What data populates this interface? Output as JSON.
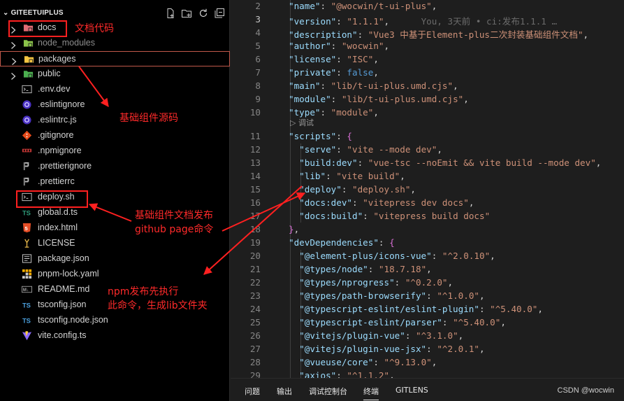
{
  "explorer": {
    "title": "GITEETUIPLUS",
    "actions": [
      "new-file-icon",
      "new-folder-icon",
      "refresh-icon",
      "collapse-all-icon"
    ],
    "items": [
      {
        "name": "docs",
        "kind": "folder",
        "icon": "docs-folder-icon",
        "icon_color": "#e06c75"
      },
      {
        "name": "node_modules",
        "kind": "folder",
        "icon": "node-folder-icon",
        "icon_color": "#8bc34a",
        "dimmed": true
      },
      {
        "name": "packages",
        "kind": "folder",
        "icon": "package-folder-icon",
        "icon_color": "#f4c542"
      },
      {
        "name": "public",
        "kind": "folder",
        "icon": "public-folder-icon",
        "icon_color": "#4caf50"
      },
      {
        "name": ".env.dev",
        "kind": "file",
        "icon": "env-file-icon"
      },
      {
        "name": ".eslintignore",
        "kind": "file",
        "icon": "eslint-icon"
      },
      {
        "name": ".eslintrc.js",
        "kind": "file",
        "icon": "eslint-icon"
      },
      {
        "name": ".gitignore",
        "kind": "file",
        "icon": "git-icon"
      },
      {
        "name": ".npmignore",
        "kind": "file",
        "icon": "npm-icon"
      },
      {
        "name": ".prettierignore",
        "kind": "file",
        "icon": "prettier-icon"
      },
      {
        "name": ".prettierrc",
        "kind": "file",
        "icon": "prettier-icon"
      },
      {
        "name": "deploy.sh",
        "kind": "file",
        "icon": "terminal-file-icon"
      },
      {
        "name": "global.d.ts",
        "kind": "file",
        "icon": "typescript-icon",
        "icon_text": "TS"
      },
      {
        "name": "index.html",
        "kind": "file",
        "icon": "html5-icon",
        "icon_text": "5"
      },
      {
        "name": "LICENSE",
        "kind": "file",
        "icon": "license-icon"
      },
      {
        "name": "package.json",
        "kind": "file",
        "icon": "npm-package-icon"
      },
      {
        "name": "pnpm-lock.yaml",
        "kind": "file",
        "icon": "pnpm-icon"
      },
      {
        "name": "README.md",
        "kind": "file",
        "icon": "markdown-icon",
        "icon_text": "M↓"
      },
      {
        "name": "tsconfig.json",
        "kind": "file",
        "icon": "tsconfig-icon",
        "icon_text": "TS"
      },
      {
        "name": "tsconfig.node.json",
        "kind": "file",
        "icon": "tsconfig-icon",
        "icon_text": "TS"
      },
      {
        "name": "vite.config.ts",
        "kind": "file",
        "icon": "vite-icon"
      }
    ]
  },
  "annotations": {
    "docs": "文档代码",
    "packages": "基础组件源码",
    "deploy_line1": "基础组件文档发布",
    "deploy_line2": "github page命令",
    "lib_line1": "npm发布先执行",
    "lib_line2": "此命令，生成lib文件夹",
    "color": "#ff2a2a"
  },
  "editor": {
    "blame": "You, 3天前 • ci:发布1.1.1 …",
    "codelens": "▷ 调试",
    "active_line": "3",
    "lines": [
      {
        "n": "2",
        "indent": 1,
        "parts": [
          [
            "k",
            "\"name\""
          ],
          [
            "p",
            ": "
          ],
          [
            "s",
            "\"@wocwin/t-ui-plus\""
          ],
          [
            "p",
            ","
          ]
        ]
      },
      {
        "n": "3",
        "indent": 1,
        "parts": [
          [
            "k",
            "\"version\""
          ],
          [
            "p",
            ": "
          ],
          [
            "s",
            "\"1.1.1\""
          ],
          [
            "p",
            ","
          ]
        ]
      },
      {
        "n": "4",
        "indent": 1,
        "parts": [
          [
            "k",
            "\"description\""
          ],
          [
            "p",
            ": "
          ],
          [
            "s",
            "\"Vue3 中基于Element-plus二次封装基础组件文档\""
          ],
          [
            "p",
            ","
          ]
        ]
      },
      {
        "n": "5",
        "indent": 1,
        "parts": [
          [
            "k",
            "\"author\""
          ],
          [
            "p",
            ": "
          ],
          [
            "s",
            "\"wocwin\""
          ],
          [
            "p",
            ","
          ]
        ]
      },
      {
        "n": "6",
        "indent": 1,
        "parts": [
          [
            "k",
            "\"license\""
          ],
          [
            "p",
            ": "
          ],
          [
            "s",
            "\"ISC\""
          ],
          [
            "p",
            ","
          ]
        ]
      },
      {
        "n": "7",
        "indent": 1,
        "parts": [
          [
            "k",
            "\"private\""
          ],
          [
            "p",
            ": "
          ],
          [
            "b",
            "false"
          ],
          [
            "p",
            ","
          ]
        ]
      },
      {
        "n": "8",
        "indent": 1,
        "parts": [
          [
            "k",
            "\"main\""
          ],
          [
            "p",
            ": "
          ],
          [
            "s",
            "\"lib/t-ui-plus.umd.cjs\""
          ],
          [
            "p",
            ","
          ]
        ]
      },
      {
        "n": "9",
        "indent": 1,
        "parts": [
          [
            "k",
            "\"module\""
          ],
          [
            "p",
            ": "
          ],
          [
            "s",
            "\"lib/t-ui-plus.umd.cjs\""
          ],
          [
            "p",
            ","
          ]
        ]
      },
      {
        "n": "10",
        "indent": 1,
        "parts": [
          [
            "k",
            "\"type\""
          ],
          [
            "p",
            ": "
          ],
          [
            "s",
            "\"module\""
          ],
          [
            "p",
            ","
          ]
        ]
      },
      {
        "n": "11",
        "indent": 1,
        "parts": [
          [
            "k",
            "\"scripts\""
          ],
          [
            "p",
            ": "
          ],
          [
            "br2",
            "{"
          ]
        ]
      },
      {
        "n": "12",
        "indent": 2,
        "parts": [
          [
            "k",
            "\"serve\""
          ],
          [
            "p",
            ": "
          ],
          [
            "s",
            "\"vite --mode dev\""
          ],
          [
            "p",
            ","
          ]
        ]
      },
      {
        "n": "13",
        "indent": 2,
        "parts": [
          [
            "k",
            "\"build:dev\""
          ],
          [
            "p",
            ": "
          ],
          [
            "s",
            "\"vue-tsc --noEmit && vite build --mode dev\""
          ],
          [
            "p",
            ","
          ]
        ]
      },
      {
        "n": "14",
        "indent": 2,
        "parts": [
          [
            "k",
            "\"lib\""
          ],
          [
            "p",
            ": "
          ],
          [
            "s",
            "\"vite build\""
          ],
          [
            "p",
            ","
          ]
        ]
      },
      {
        "n": "15",
        "indent": 2,
        "parts": [
          [
            "k",
            "\"deploy\""
          ],
          [
            "p",
            ": "
          ],
          [
            "s",
            "\"deploy.sh\""
          ],
          [
            "p",
            ","
          ]
        ]
      },
      {
        "n": "16",
        "indent": 2,
        "parts": [
          [
            "k",
            "\"docs:dev\""
          ],
          [
            "p",
            ": "
          ],
          [
            "s",
            "\"vitepress dev docs\""
          ],
          [
            "p",
            ","
          ]
        ]
      },
      {
        "n": "17",
        "indent": 2,
        "parts": [
          [
            "k",
            "\"docs:build\""
          ],
          [
            "p",
            ": "
          ],
          [
            "s",
            "\"vitepress build docs\""
          ]
        ]
      },
      {
        "n": "18",
        "indent": 1,
        "parts": [
          [
            "br2",
            "}"
          ],
          [
            "p",
            ","
          ]
        ]
      },
      {
        "n": "19",
        "indent": 1,
        "parts": [
          [
            "k",
            "\"devDependencies\""
          ],
          [
            "p",
            ": "
          ],
          [
            "br2",
            "{"
          ]
        ]
      },
      {
        "n": "20",
        "indent": 2,
        "parts": [
          [
            "k",
            "\"@element-plus/icons-vue\""
          ],
          [
            "p",
            ": "
          ],
          [
            "s",
            "\"^2.0.10\""
          ],
          [
            "p",
            ","
          ]
        ]
      },
      {
        "n": "21",
        "indent": 2,
        "parts": [
          [
            "k",
            "\"@types/node\""
          ],
          [
            "p",
            ": "
          ],
          [
            "s",
            "\"18.7.18\""
          ],
          [
            "p",
            ","
          ]
        ]
      },
      {
        "n": "22",
        "indent": 2,
        "parts": [
          [
            "k",
            "\"@types/nprogress\""
          ],
          [
            "p",
            ": "
          ],
          [
            "s",
            "\"^0.2.0\""
          ],
          [
            "p",
            ","
          ]
        ]
      },
      {
        "n": "23",
        "indent": 2,
        "parts": [
          [
            "k",
            "\"@types/path-browserify\""
          ],
          [
            "p",
            ": "
          ],
          [
            "s",
            "\"^1.0.0\""
          ],
          [
            "p",
            ","
          ]
        ]
      },
      {
        "n": "24",
        "indent": 2,
        "parts": [
          [
            "k",
            "\"@typescript-eslint/eslint-plugin\""
          ],
          [
            "p",
            ": "
          ],
          [
            "s",
            "\"^5.40.0\""
          ],
          [
            "p",
            ","
          ]
        ]
      },
      {
        "n": "25",
        "indent": 2,
        "parts": [
          [
            "k",
            "\"@typescript-eslint/parser\""
          ],
          [
            "p",
            ": "
          ],
          [
            "s",
            "\"^5.40.0\""
          ],
          [
            "p",
            ","
          ]
        ]
      },
      {
        "n": "26",
        "indent": 2,
        "parts": [
          [
            "k",
            "\"@vitejs/plugin-vue\""
          ],
          [
            "p",
            ": "
          ],
          [
            "s",
            "\"^3.1.0\""
          ],
          [
            "p",
            ","
          ]
        ]
      },
      {
        "n": "27",
        "indent": 2,
        "parts": [
          [
            "k",
            "\"@vitejs/plugin-vue-jsx\""
          ],
          [
            "p",
            ": "
          ],
          [
            "s",
            "\"^2.0.1\""
          ],
          [
            "p",
            ","
          ]
        ]
      },
      {
        "n": "28",
        "indent": 2,
        "parts": [
          [
            "k",
            "\"@vueuse/core\""
          ],
          [
            "p",
            ": "
          ],
          [
            "s",
            "\"^9.13.0\""
          ],
          [
            "p",
            ","
          ]
        ]
      },
      {
        "n": "29",
        "indent": 2,
        "parts": [
          [
            "k",
            "\"axios\""
          ],
          [
            "p",
            ": "
          ],
          [
            "s",
            "\"^1.1.2\""
          ],
          [
            "p",
            ","
          ]
        ]
      }
    ]
  },
  "panel": {
    "tabs": [
      "问题",
      "输出",
      "调试控制台",
      "终端",
      "GITLENS"
    ],
    "active": "终端"
  },
  "watermark": "CSDN @wocwin"
}
